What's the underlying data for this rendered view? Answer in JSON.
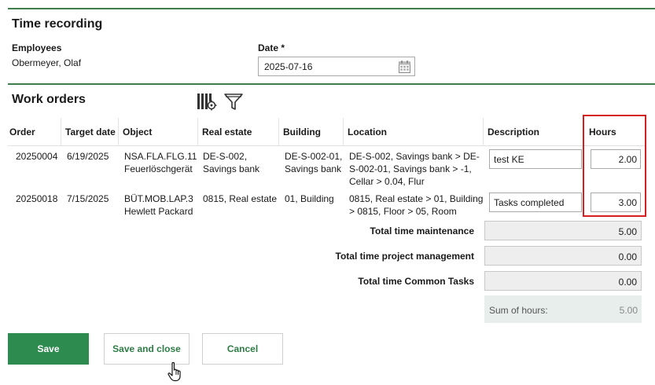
{
  "header": {
    "title": "Time recording",
    "employees_label": "Employees",
    "employee_name": "Obermeyer, Olaf",
    "date_label": "Date *",
    "date_value": "2025-07-16"
  },
  "work_orders": {
    "title": "Work orders",
    "columns": [
      "Order",
      "Target date",
      "Object",
      "Real estate",
      "Building",
      "Location",
      "Description",
      "Hours"
    ],
    "rows": [
      {
        "order": "20250004",
        "target_date": "6/19/2025",
        "object_line1": "NSA.FLA.FLG.11",
        "object_line2": "Feuerlöschgerät",
        "real_estate_line1": "DE-S-002,",
        "real_estate_line2": "Savings bank",
        "building_line1": "DE-S-002-01,",
        "building_line2": "Savings bank",
        "location_line1": "DE-S-002, Savings bank > DE-",
        "location_line2": "S-002-01, Savings bank > -1,",
        "location_line3": "Cellar > 0.04, Flur",
        "description": "test KE",
        "hours": "2.00"
      },
      {
        "order": "20250018",
        "target_date": "7/15/2025",
        "object_line1": "BÜT.MOB.LAP.3",
        "object_line2": "Hewlett Packard",
        "real_estate_line1": "0815, Real estate",
        "real_estate_line2": "",
        "building_line1": "01, Building",
        "building_line2": "",
        "location_line1": "0815, Real estate > 01, Building",
        "location_line2": "> 0815, Floor > 05, Room",
        "location_line3": "",
        "description": "Tasks completed",
        "hours": "3.00"
      }
    ]
  },
  "totals": {
    "maintenance_label": "Total time maintenance",
    "maintenance_value": "5.00",
    "project_label": "Total time project management",
    "project_value": "0.00",
    "common_label": "Total time Common Tasks",
    "common_value": "0.00",
    "sum_label": "Sum of hours:",
    "sum_value": "5.00"
  },
  "buttons": {
    "save": "Save",
    "save_close": "Save and close",
    "cancel": "Cancel"
  },
  "icons": {
    "columns_config": "column-settings-icon",
    "filter": "funnel-filter-icon",
    "calendar": "calendar-icon",
    "cursor": "hand-pointer-cursor"
  },
  "colors": {
    "accent_green": "#2e8b4f",
    "rule_green": "#3f7d4c",
    "highlight_red": "#d42020"
  }
}
